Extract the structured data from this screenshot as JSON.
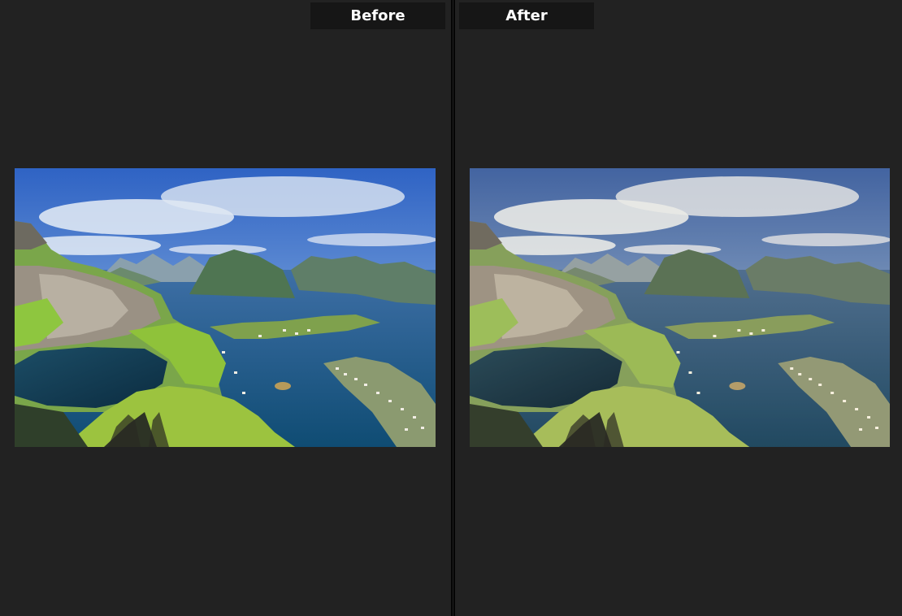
{
  "labels": {
    "before": "Before",
    "after": "After"
  },
  "colors": {
    "background": "#222222",
    "label_bg": "#161616",
    "label_text": "#ffffff",
    "divider": "#050505"
  }
}
